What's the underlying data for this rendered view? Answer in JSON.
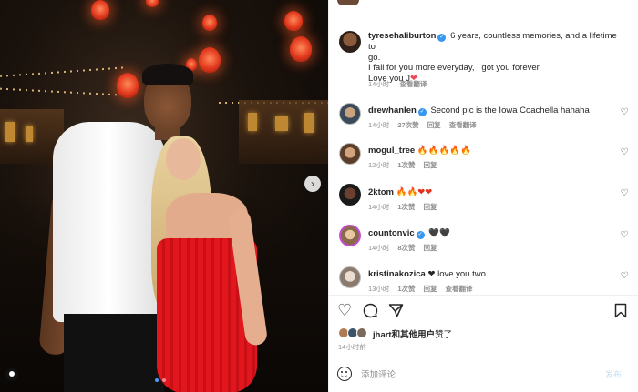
{
  "post": {
    "author": "tyresehaliburton",
    "caption_line1": "6 years, countless memories, and a lifetime to",
    "caption_line2": "go.",
    "caption_line3": "I fall for you more everyday, I got you forever.",
    "caption_line4": "Love you J",
    "caption_heart": "❤",
    "time": "14小时",
    "see_translation": "查看翻译"
  },
  "comments": [
    {
      "user": "drewhanlen",
      "text": "Second pic is the Iowa Coachella hahaha",
      "verified": true,
      "time": "14小时",
      "likes": "27次赞",
      "reply": "回复",
      "translate": "查看翻译"
    },
    {
      "user": "mogul_tree",
      "text": "🔥🔥🔥🔥🔥",
      "verified": false,
      "time": "12小时",
      "likes": "1次赞",
      "reply": "回复",
      "translate": ""
    },
    {
      "user": "2ktom",
      "text": "🔥🔥❤❤",
      "verified": false,
      "time": "14小时",
      "likes": "1次赞",
      "reply": "回复",
      "translate": ""
    },
    {
      "user": "countonvic",
      "text": "🖤🖤",
      "verified": true,
      "time": "14小时",
      "likes": "8次赞",
      "reply": "回复",
      "translate": ""
    },
    {
      "user": "kristinakozica",
      "text": "❤ love you two",
      "verified": false,
      "time": "13小时",
      "likes": "1次赞",
      "reply": "回复",
      "translate": "查看翻译"
    }
  ],
  "likes": {
    "liked_by": "jhart",
    "rest": "和其他用户",
    "suffix": "赞了"
  },
  "post_time": "14小时前",
  "comment_box": {
    "placeholder": "添加评论...",
    "post_label": "发布"
  },
  "icons": {
    "like": "heart-outline",
    "comment": "speech-bubble",
    "share": "paper-plane",
    "save": "bookmark",
    "carousel_next": "chevron-right",
    "tag": "user-tag",
    "emoji": "smiley-face"
  }
}
